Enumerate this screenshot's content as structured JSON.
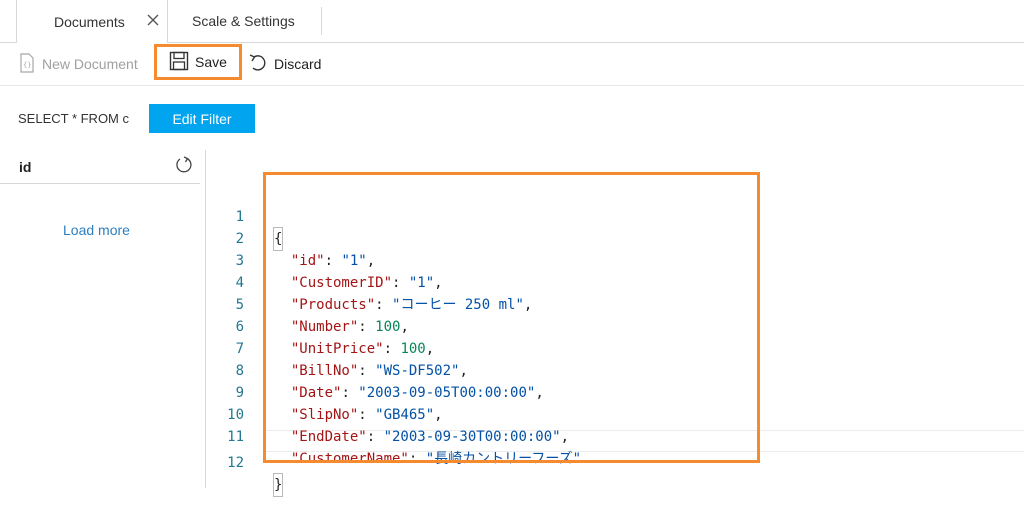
{
  "tabs": [
    {
      "label": "Documents"
    },
    {
      "label": "Scale & Settings"
    }
  ],
  "toolbar": {
    "new_document": "New Document",
    "save": "Save",
    "discard": "Discard"
  },
  "filter": {
    "query": "SELECT * FROM c",
    "edit_button": "Edit Filter"
  },
  "list": {
    "column": "id",
    "load_more": "Load more"
  },
  "editor": {
    "line_numbers": [
      "1",
      "2",
      "3",
      "4",
      "5",
      "6",
      "7",
      "8",
      "9",
      "10",
      "11",
      "12"
    ],
    "fields": [
      {
        "key": "\"id\"",
        "value": "\"1\"",
        "type": "string"
      },
      {
        "key": "\"CustomerID\"",
        "value": "\"1\"",
        "type": "string"
      },
      {
        "key": "\"Products\"",
        "value": "\"コーヒー 250 ml\"",
        "type": "string"
      },
      {
        "key": "\"Number\"",
        "value": "100",
        "type": "number"
      },
      {
        "key": "\"UnitPrice\"",
        "value": "100",
        "type": "number"
      },
      {
        "key": "\"BillNo\"",
        "value": "\"WS-DF502\"",
        "type": "string"
      },
      {
        "key": "\"Date\"",
        "value": "\"2003-09-05T00:00:00\"",
        "type": "string"
      },
      {
        "key": "\"SlipNo\"",
        "value": "\"GB465\"",
        "type": "string"
      },
      {
        "key": "\"EndDate\"",
        "value": "\"2003-09-30T00:00:00\"",
        "type": "string"
      },
      {
        "key": "\"CustomerName\"",
        "value": "\"長崎カントリーフーズ\"",
        "type": "string"
      }
    ],
    "open_brace": "{",
    "close_brace": "}"
  },
  "colors": {
    "accent": "#00a4ef",
    "highlight": "#f58a2e"
  }
}
